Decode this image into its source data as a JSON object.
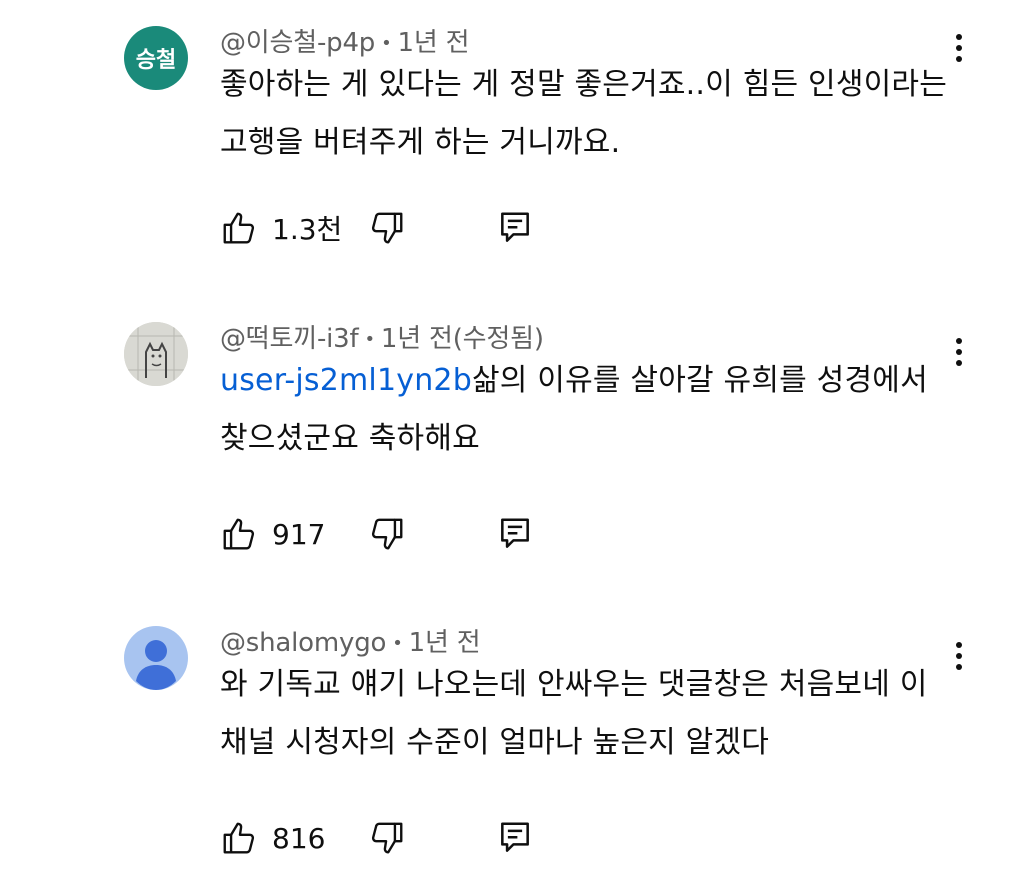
{
  "comments": [
    {
      "author": "@이승철-p4p",
      "separator": "•",
      "time": "1년 전",
      "avatar_text": "승철",
      "avatar_color": "#1a8a7a",
      "mention": "",
      "text": "좋아하는 게 있다는 게 정말 좋은거죠..이 힘든 인생이라는 고행을 버텨주게 하는 거니까요.",
      "likes": "1.3천"
    },
    {
      "author": "@떡토끼-i3f",
      "separator": "•",
      "time": "1년 전(수정됨)",
      "avatar_text": "",
      "avatar_icon": "cat-sketch-avatar",
      "mention": "user-js2ml1yn2b",
      "text": "삶의 이유를 살아갈 유희를 성경에서 찾으셨군요 축하해요",
      "likes": "917"
    },
    {
      "author": "@shalomygo",
      "separator": "•",
      "time": "1년 전",
      "avatar_text": "",
      "avatar_icon": "default-person-avatar",
      "avatar_color": "#a8c4f0",
      "mention": "",
      "text": "와 기독교 얘기 나오는데 안싸우는 댓글창은 처음보네 이 채널 시청자의 수준이 얼마나 높은지 알겠다",
      "likes": "816"
    }
  ],
  "icons": {
    "like": "thumbs-up-icon",
    "dislike": "thumbs-down-icon",
    "reply": "reply-comment-icon",
    "menu": "more-vert-icon"
  },
  "colors": {
    "mention": "#065fd4",
    "meta": "#606060",
    "text": "#0f0f0f"
  }
}
